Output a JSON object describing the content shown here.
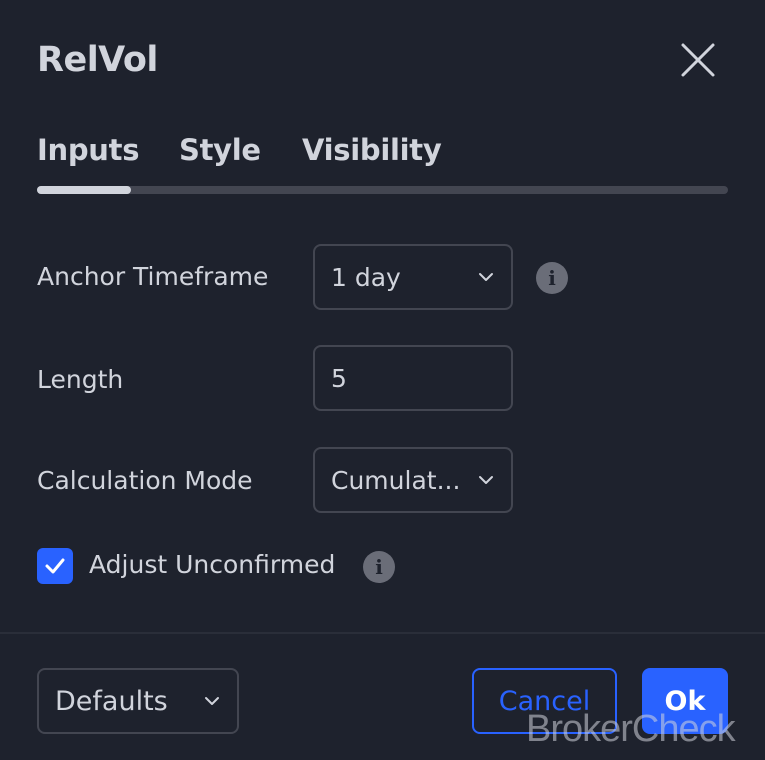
{
  "dialog": {
    "title": "RelVol"
  },
  "tabs": [
    {
      "label": "Inputs",
      "active": true
    },
    {
      "label": "Style",
      "active": false
    },
    {
      "label": "Visibility",
      "active": false
    }
  ],
  "inputs": {
    "anchor_timeframe": {
      "label": "Anchor Timeframe",
      "value": "1 day"
    },
    "length": {
      "label": "Length",
      "value": "5"
    },
    "calculation_mode": {
      "label": "Calculation Mode",
      "value": "Cumulat..."
    },
    "adjust_unconfirmed": {
      "label": "Adjust Unconfirmed",
      "checked": true
    }
  },
  "footer": {
    "defaults_label": "Defaults",
    "cancel_label": "Cancel",
    "ok_label": "Ok"
  },
  "watermark": "BrokerCheck",
  "icons": {
    "close": "close-icon",
    "info": "info-icon",
    "chevron": "chevron-down-icon",
    "check": "checkmark-icon"
  },
  "colors": {
    "background": "#1e222d",
    "text": "#d1d4dc",
    "accent": "#2962ff",
    "border": "#434651"
  }
}
